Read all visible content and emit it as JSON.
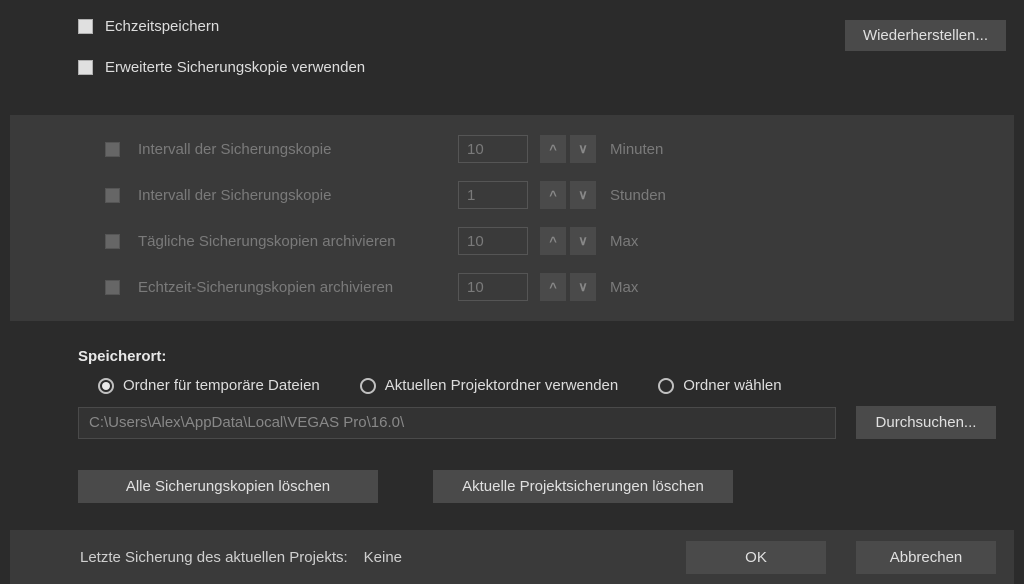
{
  "top": {
    "realtime_save": "Echzeitspeichern",
    "extended_backup": "Erweiterte Sicherungskopie verwenden"
  },
  "restore_btn": "Wiederherstellen...",
  "panel": {
    "rows": [
      {
        "label": "Intervall der Sicherungskopie",
        "value": "10",
        "unit": "Minuten"
      },
      {
        "label": "Intervall der Sicherungskopie",
        "value": "1",
        "unit": "Stunden"
      },
      {
        "label": "Tägliche Sicherungskopien archivieren",
        "value": "10",
        "unit": "Max"
      },
      {
        "label": "Echtzeit-Sicherungskopien archivieren",
        "value": "10",
        "unit": "Max"
      }
    ]
  },
  "location": {
    "title": "Speicherort:",
    "radios": {
      "temp": "Ordner für temporäre Dateien",
      "project": "Aktuellen Projektordner verwenden",
      "choose": "Ordner wählen"
    },
    "path": "C:\\Users\\Alex\\AppData\\Local\\VEGAS Pro\\16.0\\",
    "browse": "Durchsuchen..."
  },
  "delete": {
    "all": "Alle Sicherungskopien löschen",
    "current": "Aktuelle Projektsicherungen löschen"
  },
  "bottom": {
    "label": "Letzte Sicherung des aktuellen Projekts:",
    "value": "Keine",
    "ok": "OK",
    "cancel": "Abbrechen"
  }
}
